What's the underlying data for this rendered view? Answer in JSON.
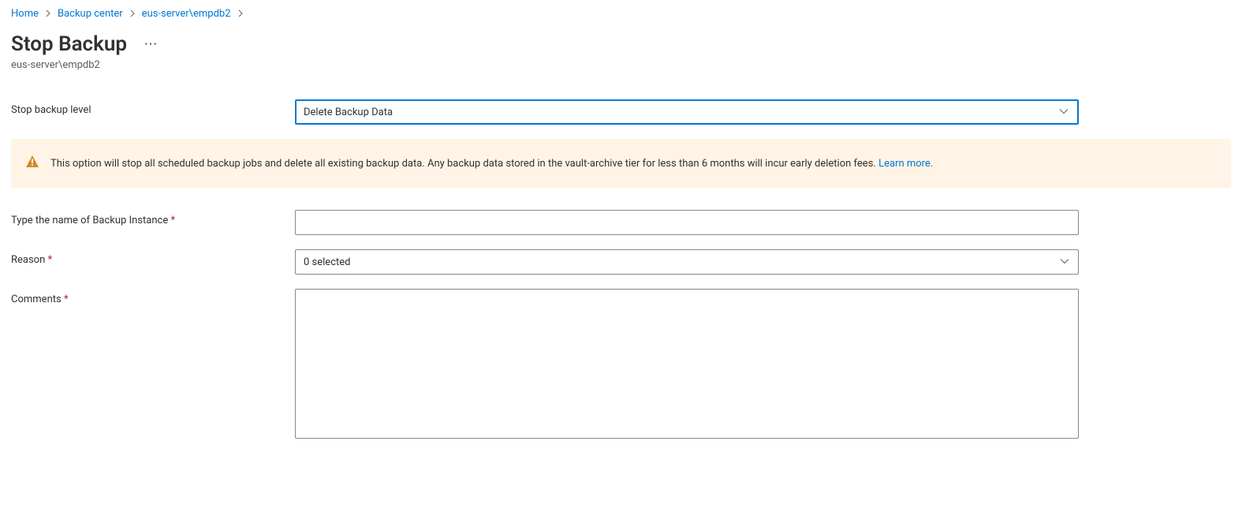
{
  "breadcrumb": {
    "items": [
      {
        "label": "Home"
      },
      {
        "label": "Backup center"
      },
      {
        "label": "eus-server\\empdb2"
      }
    ]
  },
  "page": {
    "title": "Stop Backup",
    "subtitle": "eus-server\\empdb2"
  },
  "form": {
    "stopBackupLevel": {
      "label": "Stop backup level",
      "value": "Delete Backup Data"
    },
    "alert": {
      "text": "This option will stop all scheduled backup jobs and delete all existing backup data. Any backup data stored in the vault-archive tier for less than 6 months will incur early deletion fees.",
      "linkText": "Learn more."
    },
    "instanceName": {
      "label": "Type the name of Backup Instance",
      "value": ""
    },
    "reason": {
      "label": "Reason",
      "value": "0 selected"
    },
    "comments": {
      "label": "Comments",
      "value": ""
    }
  }
}
